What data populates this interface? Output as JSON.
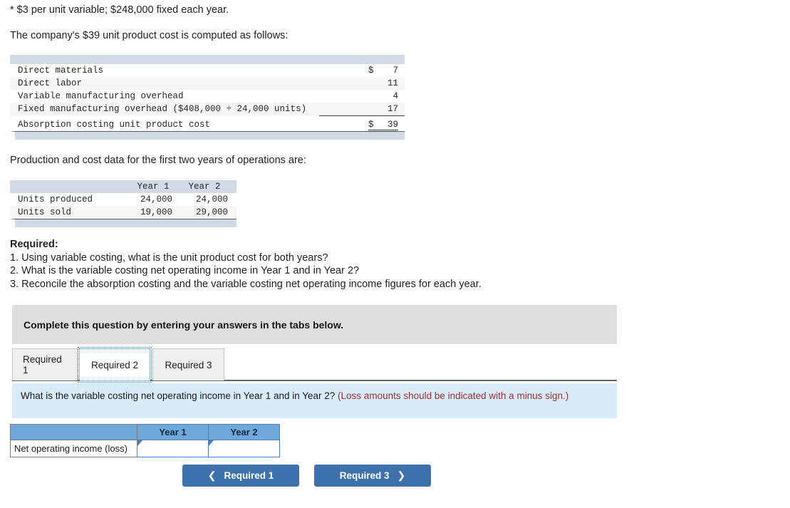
{
  "intro": {
    "footnote": "* $3 per unit variable; $248,000 fixed each year.",
    "sentence": "The company's $39 unit product cost is computed as follows:",
    "production_lead": "Production and cost data for the first two years of operations are:"
  },
  "cost_table": {
    "rows": [
      {
        "label": "Direct materials",
        "currency": "$",
        "amount": "7"
      },
      {
        "label": "Direct labor",
        "currency": "",
        "amount": "11"
      },
      {
        "label": "Variable manufacturing overhead",
        "currency": "",
        "amount": "4"
      },
      {
        "label": "Fixed manufacturing overhead ($408,000 ÷ 24,000 units)",
        "currency": "",
        "amount": "17"
      }
    ],
    "total": {
      "label": "Absorption costing unit product cost",
      "currency": "$",
      "amount": "39"
    }
  },
  "units_table": {
    "headers": [
      "",
      "Year 1",
      "Year 2"
    ],
    "rows": [
      {
        "label": "Units produced",
        "year1": "24,000",
        "year2": "24,000"
      },
      {
        "label": "Units sold",
        "year1": "19,000",
        "year2": "29,000"
      }
    ]
  },
  "required": {
    "title": "Required:",
    "items": [
      "1. Using variable costing, what is the unit product cost for both years?",
      "2. What is the variable costing net operating income in Year 1 and in Year 2?",
      "3. Reconcile the absorption costing and the variable costing net operating income figures for each year."
    ]
  },
  "instruction_banner": {
    "text": "Complete this question by entering your answers in the tabs below."
  },
  "tabs": [
    {
      "label": "Required 1",
      "active": false
    },
    {
      "label": "Required 2",
      "active": true
    },
    {
      "label": "Required 3",
      "active": false
    }
  ],
  "question": {
    "prompt": "What is the variable costing net operating income in Year 1 and in Year 2? ",
    "warning": "(Loss amounts should be indicated with a minus sign.)"
  },
  "answer_table": {
    "header_blank": "",
    "header_year1": "Year 1",
    "header_year2": "Year 2",
    "row_label": "Net operating income (loss)",
    "year1_value": "",
    "year2_value": ""
  },
  "nav": {
    "prev_label": "Required 1",
    "prev_icon": "chevron-left-icon",
    "next_label": "Required 3",
    "next_icon": "chevron-right-icon"
  },
  "colors": {
    "table_header_bar": "#d4dae5",
    "instruction_banner": "#dedede",
    "question_banner": "#d9ebf8",
    "warning_text": "#9b3232",
    "answer_header_blue": "#6fa8dc",
    "button_blue": "#3d72ac",
    "input_border_blue": "#4a7ebb"
  }
}
